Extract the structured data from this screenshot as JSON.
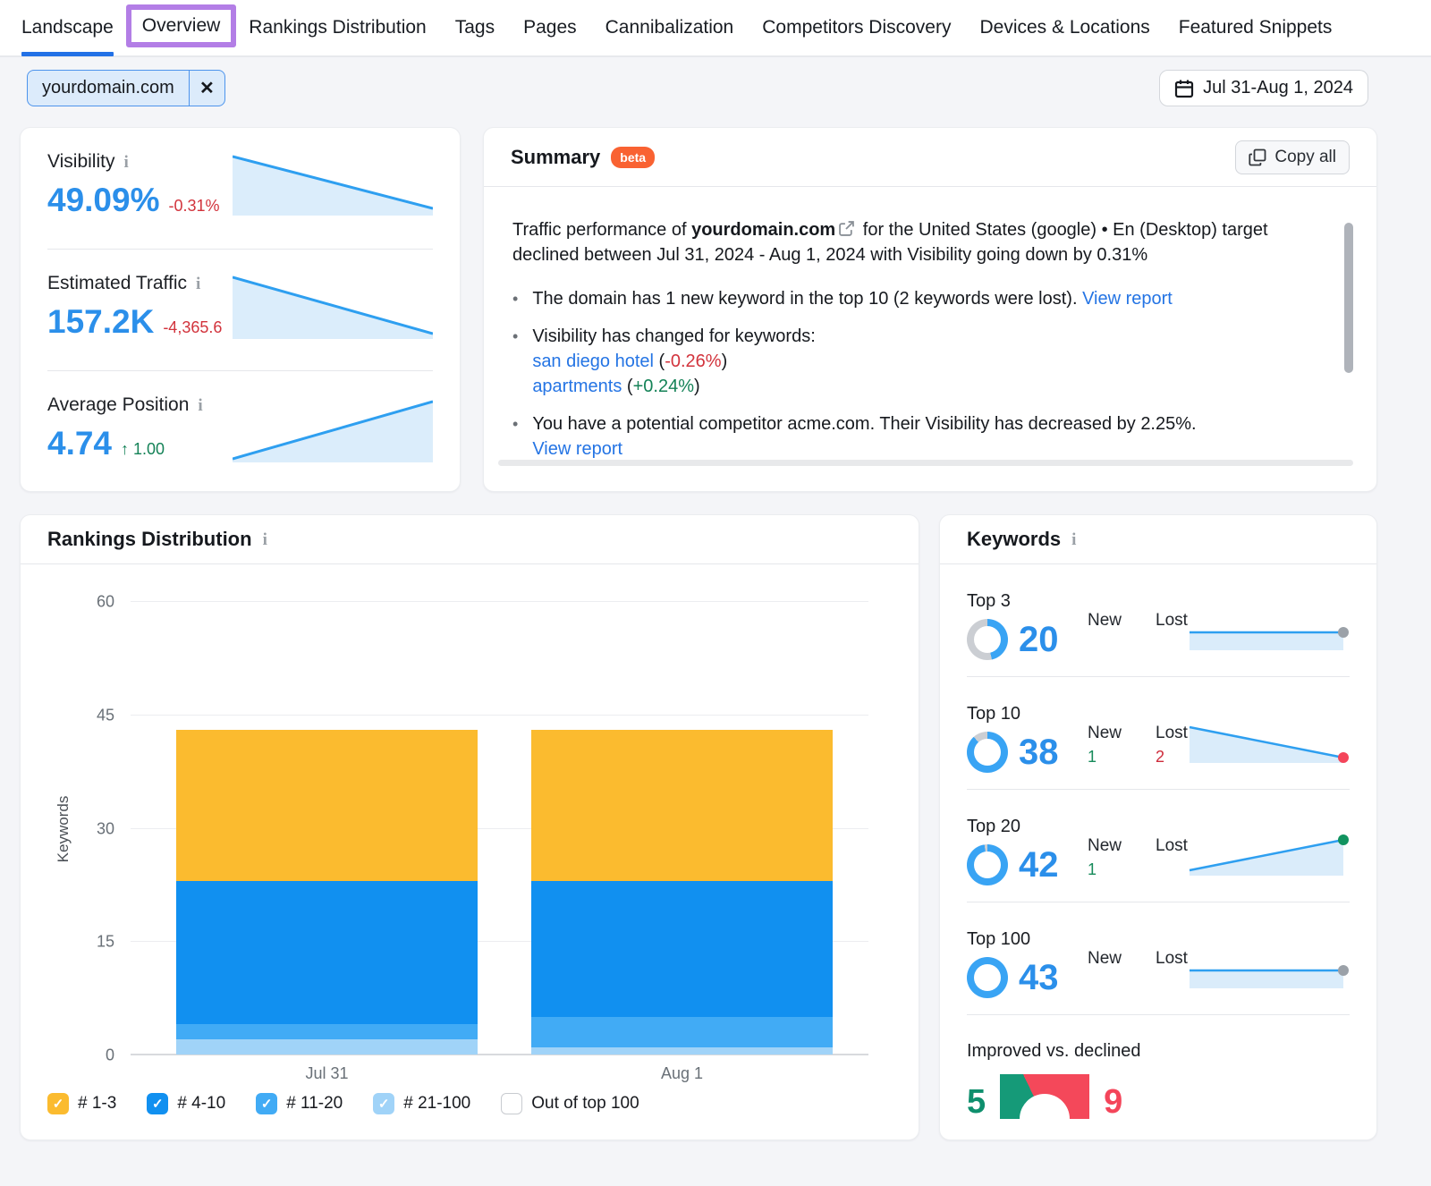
{
  "ui": {
    "check_glyph": "✓",
    "close_glyph": "✕",
    "bullet_glyph": "•",
    "info_glyph": "i"
  },
  "colors": {
    "accent_blue": "#2B8FEA",
    "link_blue": "#2474E4",
    "active_tab_blue": "#2271E6",
    "highlight_purple": "#B37EE6",
    "negative_red": "#D2333C",
    "positive_green": "#148257",
    "beta_orange": "#F96232",
    "donut_blue": "#39A4F4",
    "donut_track": "#CBCED3",
    "gauge_green": "#159A78",
    "gauge_red": "#F4485A",
    "spark_line": "#2E9FF0",
    "spark_fill": "#DBEDFB"
  },
  "nav": {
    "tabs": [
      {
        "label": "Landscape",
        "active": true
      },
      {
        "label": "Overview",
        "highlighted": true
      },
      {
        "label": "Rankings Distribution"
      },
      {
        "label": "Tags"
      },
      {
        "label": "Pages"
      },
      {
        "label": "Cannibalization"
      },
      {
        "label": "Competitors Discovery"
      },
      {
        "label": "Devices & Locations"
      },
      {
        "label": "Featured Snippets"
      }
    ]
  },
  "toolbar": {
    "domain_chip": {
      "label": "yourdomain.com"
    },
    "date_range": "Jul 31-Aug 1, 2024"
  },
  "metrics": {
    "visibility": {
      "label": "Visibility",
      "value": "49.09%",
      "delta": "-0.31%",
      "delta_color": "red",
      "trend": "down"
    },
    "estimated_traffic": {
      "label": "Estimated Traffic",
      "value": "157.2K",
      "delta": "-4,365.6",
      "delta_color": "red",
      "trend": "down"
    },
    "average_position": {
      "label": "Average Position",
      "value": "4.74",
      "delta": "↑ 1.00",
      "delta_color": "green",
      "trend": "up"
    }
  },
  "summary": {
    "title": "Summary",
    "beta_badge": "beta",
    "copy_all_label": "Copy all",
    "intro": [
      {
        "t": "Traffic performance of "
      },
      {
        "t": "yourdomain.com",
        "s": "bold"
      },
      {
        "s": "icon"
      },
      {
        "t": " for the United States (google) • En (Desktop) target declined between Jul 31, 2024 - Aug 1, 2024 with Visibility going down by 0.31%"
      }
    ],
    "bullets": [
      [
        {
          "t": "The domain has 1 new keyword in the top 10 (2 keywords were lost). "
        },
        {
          "t": "View report",
          "s": "link"
        }
      ],
      [
        {
          "t": "Visibility has changed for keywords:"
        },
        {
          "s": "br"
        },
        {
          "t": "san diego hotel",
          "s": "link"
        },
        {
          "t": " ("
        },
        {
          "t": "-0.26%",
          "s": "red"
        },
        {
          "t": ")"
        },
        {
          "s": "br"
        },
        {
          "t": "apartments",
          "s": "link"
        },
        {
          "t": " ("
        },
        {
          "t": "+0.24%",
          "s": "green"
        },
        {
          "t": ")"
        }
      ],
      [
        {
          "t": "You have a potential competitor acme.com. Their Visibility has decreased by 2.25%."
        },
        {
          "s": "br"
        },
        {
          "t": "View report",
          "s": "link"
        }
      ]
    ]
  },
  "chart_data": {
    "type": "bar",
    "stacked": true,
    "title": "Rankings Distribution",
    "ylabel": "Keywords",
    "xlabel": "",
    "ylim": [
      0,
      60
    ],
    "yticks": [
      0,
      15,
      30,
      45,
      60
    ],
    "grid": true,
    "categories": [
      "Jul 31",
      "Aug 1"
    ],
    "series": [
      {
        "name": "# 21-100",
        "values": [
          2,
          1
        ],
        "color": "#A0D3F8"
      },
      {
        "name": "# 11-20",
        "values": [
          2,
          4
        ],
        "color": "#41ABF5"
      },
      {
        "name": "# 4-10",
        "values": [
          19,
          18
        ],
        "color": "#1190F0"
      },
      {
        "name": "# 1-3",
        "values": [
          20,
          20
        ],
        "color": "#FBBB2F"
      }
    ],
    "legend_position": "bottom",
    "legend": [
      {
        "label": "# 1-3",
        "checked": true,
        "color": "#FBBB2F"
      },
      {
        "label": "# 4-10",
        "checked": true,
        "color": "#1190F0"
      },
      {
        "label": "# 11-20",
        "checked": true,
        "color": "#41ABF5"
      },
      {
        "label": "# 21-100",
        "checked": true,
        "color": "#A0D3F8"
      },
      {
        "label": "Out of top 100",
        "checked": false,
        "color": "#FFFFFF"
      }
    ]
  },
  "keywords": {
    "title": "Keywords",
    "donut_total": 43,
    "rows": [
      {
        "label": "Top 3",
        "value": 20,
        "new_label": "New",
        "lost_label": "Lost",
        "new_value": "",
        "lost_value": "",
        "trend": "flat",
        "endpoint": "gray"
      },
      {
        "label": "Top 10",
        "value": 38,
        "new_label": "New",
        "lost_label": "Lost",
        "new_value": "1",
        "lost_value": "2",
        "trend": "down",
        "endpoint": "red"
      },
      {
        "label": "Top 20",
        "value": 42,
        "new_label": "New",
        "lost_label": "Lost",
        "new_value": "1",
        "lost_value": "",
        "trend": "up",
        "endpoint": "green"
      },
      {
        "label": "Top 100",
        "value": 43,
        "new_label": "New",
        "lost_label": "Lost",
        "new_value": "",
        "lost_value": "",
        "trend": "flat",
        "endpoint": "gray"
      }
    ],
    "improved_vs_declined": {
      "label": "Improved vs. declined",
      "improved": 5,
      "declined": 9
    }
  }
}
